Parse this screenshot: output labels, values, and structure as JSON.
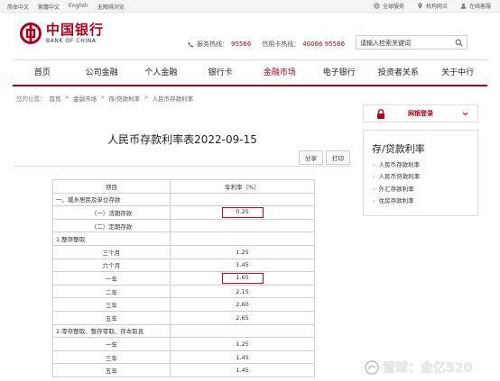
{
  "topbar": {
    "langs": [
      "简体中文",
      "繁體中文",
      "English",
      "无障碍浏览"
    ],
    "tools": [
      "全球服务",
      "机构网点",
      "在线客服"
    ]
  },
  "header": {
    "logo_cn": "中国银行",
    "logo_en": "BANK OF CHINA",
    "service_label": "服务热线：",
    "service_num": "95566",
    "card_label": "信用卡热线：",
    "card_num": "40066 95566",
    "search_placeholder": "请输入检索关键词"
  },
  "nav": [
    "首页",
    "公司金融",
    "个人金融",
    "银行卡",
    "金融市场",
    "电子银行",
    "投资者关系",
    "关于中行"
  ],
  "nav_active": "金融市场",
  "breadcrumb": {
    "label": "您的位置：",
    "items": [
      "首页",
      ">",
      "金融市场",
      ">",
      "存/贷款利率",
      ">",
      "人民币存款利率"
    ]
  },
  "main": {
    "title": "人民币存款利率表2022-09-15",
    "share": "分享",
    "print": "打印"
  },
  "table": {
    "header": [
      "项目",
      "年利率（%）"
    ],
    "rows": [
      {
        "item": "一、城乡居民及单位存款",
        "rate": "",
        "type": "section"
      },
      {
        "item": "（一）活期存款",
        "rate": "0.25",
        "type": "sub",
        "highlight": true
      },
      {
        "item": "（二）定期存款",
        "rate": "",
        "type": "sub"
      },
      {
        "item": "1.整存整取",
        "rate": "",
        "type": "section"
      },
      {
        "item": "三个月",
        "rate": "1.25",
        "type": "term"
      },
      {
        "item": "六个月",
        "rate": "1.45",
        "type": "term"
      },
      {
        "item": "一年",
        "rate": "1.65",
        "type": "term",
        "highlight": true
      },
      {
        "item": "二年",
        "rate": "2.15",
        "type": "term"
      },
      {
        "item": "三年",
        "rate": "2.60",
        "type": "term"
      },
      {
        "item": "五年",
        "rate": "2.65",
        "type": "term"
      },
      {
        "item": "2.零存整取、整存零取、存本取息",
        "rate": "",
        "type": "section"
      },
      {
        "item": "一年",
        "rate": "1.25",
        "type": "term"
      },
      {
        "item": "三年",
        "rate": "1.45",
        "type": "term"
      },
      {
        "item": "五年",
        "rate": "1.45",
        "type": "term"
      }
    ]
  },
  "sidebar": {
    "login": "网银登录",
    "heading": "存/贷款利率",
    "links": [
      "人民币存款利率",
      "人民币贷款利率",
      "外汇存款利率",
      "住房存款利率"
    ]
  },
  "watermark": "雪球：金亿520",
  "colors": {
    "brand": "#b1001c",
    "highlight_box": "#e60012"
  }
}
